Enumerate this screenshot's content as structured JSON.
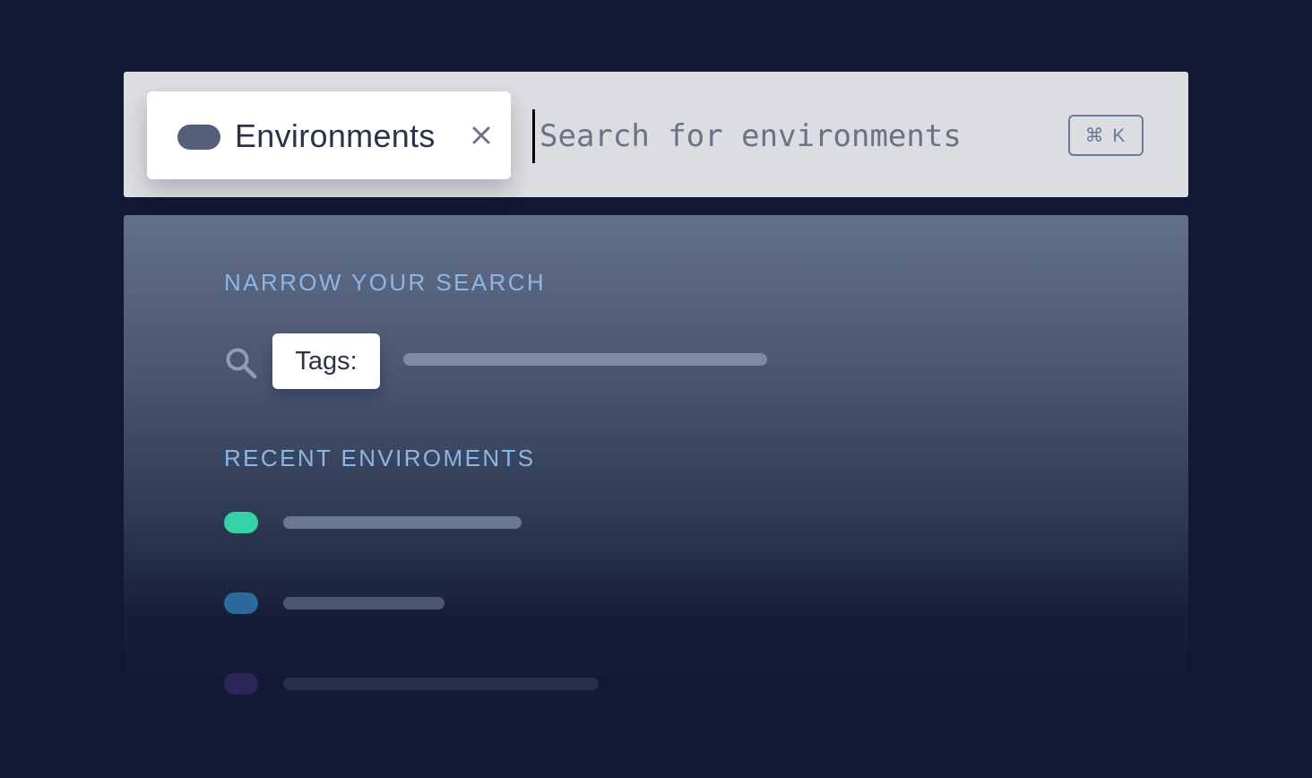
{
  "search": {
    "scope_label": "Environments",
    "placeholder": "Search for environments",
    "shortcut": "⌘ K"
  },
  "panel": {
    "narrow_heading": "NARROW YOUR SEARCH",
    "tags_label": "Tags:",
    "recent_heading": "RECENT ENVIROMENTS"
  },
  "colors": {
    "background": "#111833",
    "search_bar": "#dcdde1",
    "heading": "#8db6e6",
    "scope_pill": "#546079",
    "recent_1": "#34d3a6",
    "recent_2": "#2a6a9c",
    "recent_3": "#2d2658"
  },
  "icons": {
    "close": "close-icon",
    "search": "search-icon"
  }
}
